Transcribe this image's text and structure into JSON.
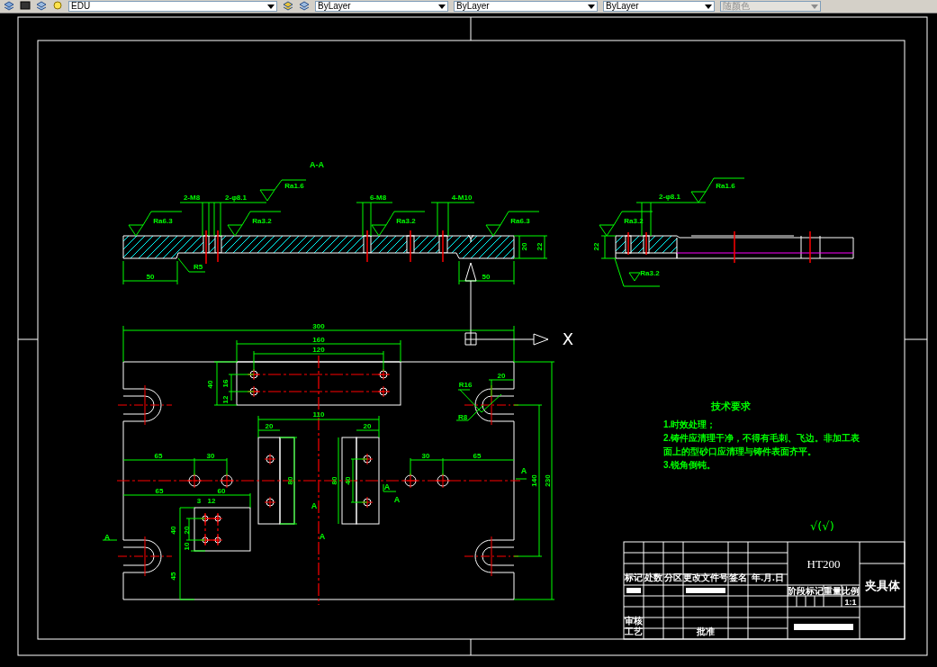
{
  "toolbar": {
    "layer": "EDU",
    "color_setting": "ByLayer",
    "linetype": "ByLayer",
    "lineweight": "ByLayer",
    "plot_style": {
      "value": "随颜色",
      "disabled": true
    }
  },
  "section_view": {
    "title": "A-A",
    "labels": [
      {
        "text": "2-M8",
        "kind": "dim"
      },
      {
        "text": "2-φ8.1",
        "kind": "dim"
      },
      {
        "text": "Ra1.6",
        "kind": "dim"
      },
      {
        "text": "6-M8",
        "kind": "dim"
      },
      {
        "text": "4-M10",
        "kind": "dim"
      },
      {
        "text": "Ra6.3",
        "kind": "dim"
      },
      {
        "text": "Ra3.2",
        "kind": "dim"
      },
      {
        "text": "Ra3.2",
        "kind": "dim"
      },
      {
        "text": "Ra6.3",
        "kind": "dim"
      },
      {
        "text": "R5",
        "kind": "dim"
      },
      {
        "text": "50",
        "kind": "dim"
      },
      {
        "text": "50",
        "kind": "dim"
      },
      {
        "text": "20",
        "kind": "vdim"
      },
      {
        "text": "22",
        "kind": "vdim"
      }
    ]
  },
  "side_view": {
    "labels": [
      {
        "text": "Ra1.6",
        "kind": "dim"
      },
      {
        "text": "2-φ8.1",
        "kind": "dim"
      },
      {
        "text": "Ra3.2",
        "kind": "dim"
      },
      {
        "text": "Ra3.2",
        "kind": "dim"
      },
      {
        "text": "22",
        "kind": "vdim"
      }
    ]
  },
  "plan_view": {
    "labels": [
      {
        "text": "300",
        "kind": "dim"
      },
      {
        "text": "160",
        "kind": "dim"
      },
      {
        "text": "120",
        "kind": "dim"
      },
      {
        "text": "40",
        "kind": "vdim"
      },
      {
        "text": "16",
        "kind": "vdim"
      },
      {
        "text": "12",
        "kind": "vdim"
      },
      {
        "text": "R16",
        "kind": "dim"
      },
      {
        "text": "R8",
        "kind": "dim"
      },
      {
        "text": "20",
        "kind": "dim"
      },
      {
        "text": "110",
        "kind": "dim"
      },
      {
        "text": "20",
        "kind": "dim"
      },
      {
        "text": "20",
        "kind": "dim"
      },
      {
        "text": "65",
        "kind": "dim"
      },
      {
        "text": "30",
        "kind": "dim"
      },
      {
        "text": "30",
        "kind": "dim"
      },
      {
        "text": "65",
        "kind": "dim"
      },
      {
        "text": "80",
        "kind": "vdim"
      },
      {
        "text": "80",
        "kind": "vdim"
      },
      {
        "text": "40",
        "kind": "vdim"
      },
      {
        "text": "65",
        "kind": "dim"
      },
      {
        "text": "60",
        "kind": "dim"
      },
      {
        "text": "3",
        "kind": "dim"
      },
      {
        "text": "12",
        "kind": "dim"
      },
      {
        "text": "40",
        "kind": "vdim"
      },
      {
        "text": "20",
        "kind": "vdim"
      },
      {
        "text": "10",
        "kind": "vdim"
      },
      {
        "text": "45",
        "kind": "vdim"
      },
      {
        "text": "140",
        "kind": "vdim"
      },
      {
        "text": "230",
        "kind": "vdim"
      },
      {
        "text": "A",
        "kind": "mark"
      },
      {
        "text": "A",
        "kind": "mark"
      },
      {
        "text": "A",
        "kind": "mark"
      },
      {
        "text": "A",
        "kind": "mark"
      },
      {
        "text": "A",
        "kind": "mark"
      },
      {
        "text": "A",
        "kind": "mark"
      }
    ]
  },
  "ucs_icon": {
    "x_label": "X",
    "y_label": "Y"
  },
  "technical_requirements": {
    "title": "技术要求",
    "lines": [
      "1.时效处理；",
      "2.铸件应清理干净，不得有毛刺、飞边。非加工表",
      "面上的型砂口应清理与铸件表面齐平。",
      "3.锐角倒钝。"
    ]
  },
  "roughness_note": "√(√)",
  "title_block": {
    "material": "HT200",
    "part_name": "夹具体",
    "header_labels": [
      "标记",
      "处数",
      "分区",
      "更改文件号",
      "签名",
      "年.月.日"
    ],
    "sign_labels": [
      "审核",
      "工艺",
      "批准"
    ],
    "stage_labels": [
      "阶段标记",
      "重量",
      "比例"
    ],
    "scale": "1:1"
  }
}
